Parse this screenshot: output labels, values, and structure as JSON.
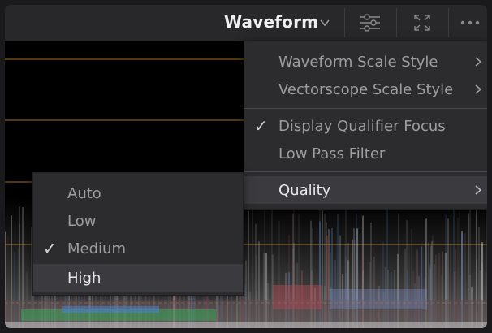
{
  "header": {
    "mode_title": "Waveform",
    "icons": [
      "chevron-down-icon",
      "sliders-icon",
      "expand-icon",
      "more-options-icon"
    ]
  },
  "context_menu": {
    "items": [
      {
        "label": "Waveform Scale Style",
        "submenu": true
      },
      {
        "label": "Vectorscope Scale Style",
        "submenu": true
      },
      {
        "label": "Display Qualifier Focus",
        "checked": true
      },
      {
        "label": "Low Pass Filter",
        "checked": false
      },
      {
        "label": "Quality",
        "submenu": true,
        "highlighted": true
      }
    ]
  },
  "quality_menu": {
    "options": [
      {
        "label": "Auto",
        "checked": false
      },
      {
        "label": "Low",
        "checked": false
      },
      {
        "label": "Medium",
        "checked": true
      },
      {
        "label": "High",
        "highlighted": true
      }
    ]
  },
  "colors": {
    "header_bg": "#28282a",
    "menu_bg": "#2c2c2f",
    "menu_highlight": "#3b3b3f",
    "guide_line": "#b07a1c"
  }
}
